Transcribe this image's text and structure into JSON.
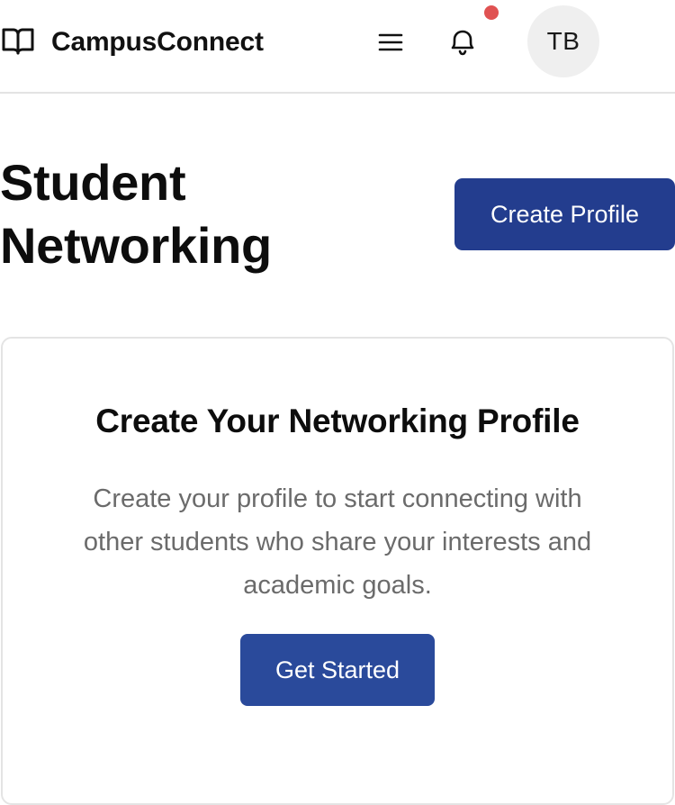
{
  "header": {
    "brand_name": "CampusConnect",
    "avatar_initials": "TB",
    "has_notification": true
  },
  "main": {
    "title": "Student Networking",
    "create_profile_label": "Create Profile"
  },
  "card": {
    "title": "Create Your Networking Profile",
    "description": "Create your profile to start connecting with other students who share your interests and academic goals.",
    "get_started_label": "Get Started"
  },
  "colors": {
    "primary_button": "#233d8e",
    "notification_dot": "#e05252",
    "avatar_bg": "#efefef",
    "muted_text": "#6b6b6b"
  },
  "icons": [
    "book-icon",
    "menu-icon",
    "bell-icon"
  ]
}
